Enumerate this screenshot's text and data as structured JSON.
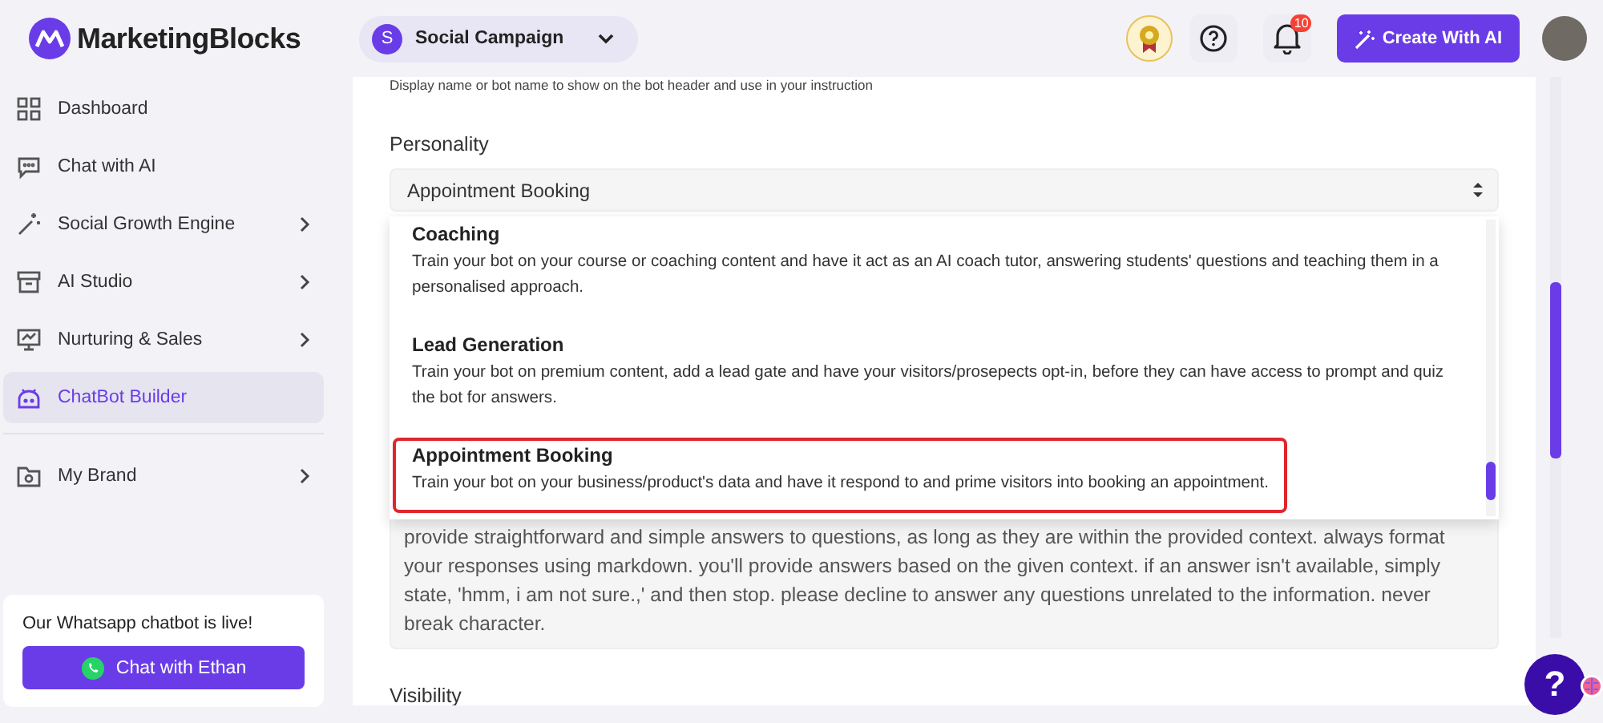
{
  "header": {
    "brand": "MarketingBlocks",
    "workspace": {
      "initial": "S",
      "name": "Social Campaign"
    },
    "notification_count": "10",
    "create_button": "Create With AI"
  },
  "sidebar": {
    "items": [
      {
        "label": "Dashboard",
        "selected": false,
        "has_submenu": false
      },
      {
        "label": "Chat with AI",
        "selected": false,
        "has_submenu": false
      },
      {
        "label": "Social Growth Engine",
        "selected": false,
        "has_submenu": true
      },
      {
        "label": "AI Studio",
        "selected": false,
        "has_submenu": true
      },
      {
        "label": "Nurturing & Sales",
        "selected": false,
        "has_submenu": true
      },
      {
        "label": "ChatBot Builder",
        "selected": true,
        "has_submenu": false
      },
      {
        "label": "My Brand",
        "selected": false,
        "has_submenu": true
      }
    ],
    "promo": {
      "text": "Our Whatsapp chatbot is live!",
      "button": "Chat with Ethan"
    }
  },
  "form": {
    "name_hint": "Display name or bot name to show on the bot header and use in your instruction",
    "personality": {
      "label": "Personality",
      "value": "Appointment Booking",
      "options": [
        {
          "title": "Coaching",
          "description": "Train your bot on your course or coaching content and have it act as an AI coach tutor, answering students' questions and teaching them in a personalised approach.",
          "highlighted": false
        },
        {
          "title": "Lead Generation",
          "description": "Train your bot on premium content, add a lead gate and have your visitors/prosepects opt-in, before they can have access to prompt and quiz the bot for answers.",
          "highlighted": false
        },
        {
          "title": "Appointment Booking",
          "description": "Train your bot on your business/product's data and have it respond to and prime visitors into booking an appointment.",
          "highlighted": true
        }
      ]
    },
    "instructions": "provide straightforward and simple answers to questions, as long as they are within the provided context. always format your responses using markdown. you'll provide answers based on the given context. if an answer isn't available, simply state, 'hmm, i am not sure.,' and then stop. please decline to answer any questions unrelated to the information. never break character.",
    "visibility": {
      "label": "Visibility"
    }
  },
  "help_button": "?"
}
